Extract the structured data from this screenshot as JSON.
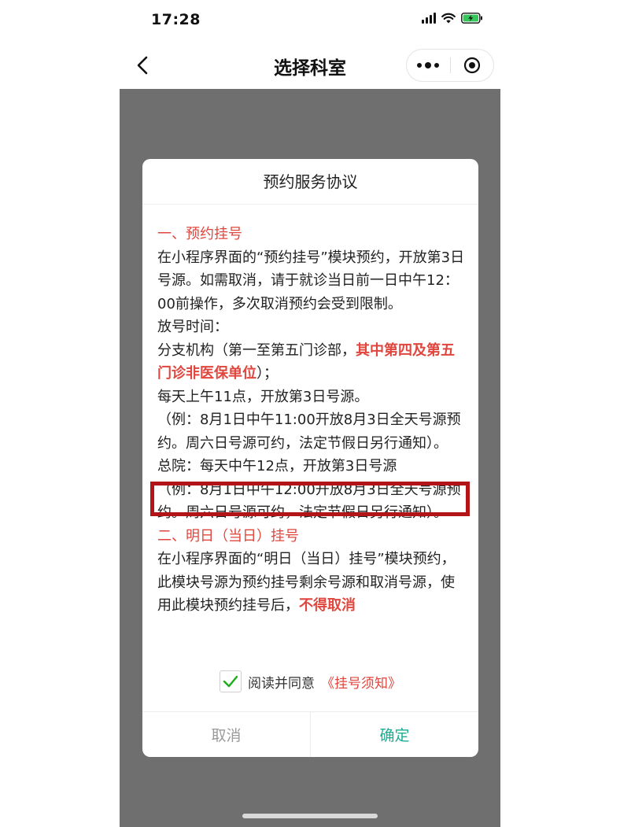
{
  "status_bar": {
    "time": "17:28"
  },
  "nav": {
    "title": "选择科室"
  },
  "dialog": {
    "title": "预约服务协议",
    "section1_heading": "一、预约挂号",
    "section1_p1": "在小程序界面的“预约挂号”模块预约，开放第3日号源。如需取消，请于就诊当日前一日中午12：00前操作，多次取消预约会受到限制。",
    "release_time_label": "放号时间：",
    "branch_prefix": "分支机构（第一至第五门诊部，",
    "branch_highlight": "其中第四及第五门诊非医保单位",
    "branch_suffix": "）；",
    "branch_schedule": "每天上午11点，开放第3日号源。",
    "branch_example": "（例：8月1日中午11:00开放8月3日全天号源预约。周六日号源可约，法定节假日另行通知）。",
    "main_schedule": "总院：每天中午12点，开放第3日号源",
    "main_example": "（例：8月1日中午12:00开放8月3日全天号源预约。周六日号源可约，法定节假日另行通知）。",
    "section2_heading": "二、明日（当日）挂号",
    "section2_p1_prefix": "在小程序界面的“明日（当日）挂号”模块预约，此模块号源为预约挂号剩余号源和取消号源，使用此模块预约挂号后，",
    "section2_p1_highlight": "不得取消",
    "agree_text": "阅读并同意",
    "agree_link": "《挂号须知》",
    "agree_checked": true,
    "cancel_label": "取消",
    "confirm_label": "确定"
  },
  "colors": {
    "accent_red": "#e0463e",
    "confirm_green": "#1aad93",
    "check_green": "#1aad19",
    "highlight_box": "#b31417",
    "overlay": "#6f6f6f"
  }
}
